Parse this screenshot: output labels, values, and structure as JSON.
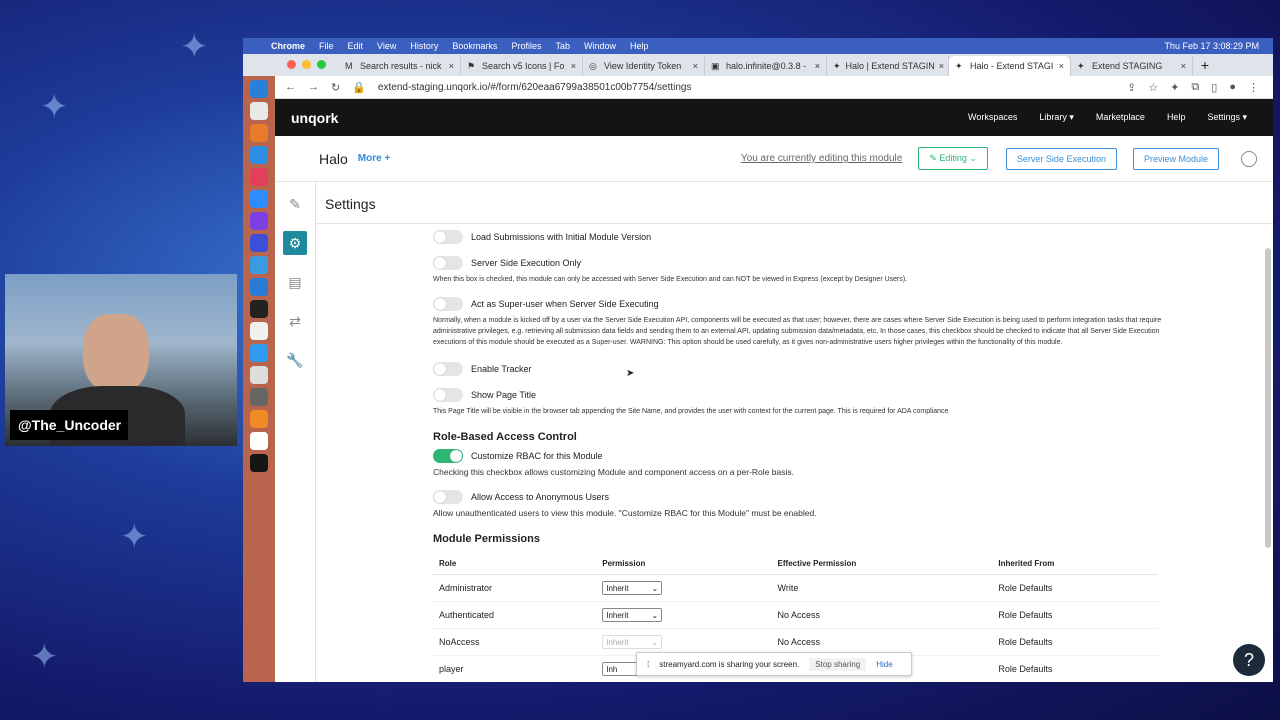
{
  "streamer": {
    "handle": "@The_Uncoder"
  },
  "menubar": {
    "app": "Chrome",
    "items": [
      "File",
      "Edit",
      "View",
      "History",
      "Bookmarks",
      "Profiles",
      "Tab",
      "Window",
      "Help"
    ],
    "clock": "Thu Feb 17  3:08:29 PM"
  },
  "tabs": [
    {
      "icon": "M",
      "label": "Search results - nick"
    },
    {
      "icon": "⚑",
      "label": "Search v5 Icons | Fo"
    },
    {
      "icon": "◎",
      "label": "View Identity Token"
    },
    {
      "icon": "▣",
      "label": "halo.infinite@0.3.8 -"
    },
    {
      "icon": "✦",
      "label": "Halo | Extend STAGIN"
    },
    {
      "icon": "✦",
      "label": "Halo - Extend STAGI"
    },
    {
      "icon": "✦",
      "label": "Extend STAGING"
    }
  ],
  "address": {
    "url": "extend-staging.unqork.io/#/form/620eaa6799a38501c00b7754/settings"
  },
  "nav": {
    "logo": "unqork",
    "links": [
      "Workspaces",
      "Library ▾",
      "Marketplace",
      "Help",
      "Settings ▾"
    ]
  },
  "header": {
    "title": "Halo",
    "more": "More +",
    "editing_note": "You are currently editing this module",
    "editing_btn": "✎  Editing  ⌄",
    "sse_btn": "Server Side Execution",
    "preview_btn": "Preview Module"
  },
  "settings": {
    "title": "Settings",
    "options": [
      {
        "label": "Load Submissions with Initial Module Version",
        "on": false,
        "desc": ""
      },
      {
        "label": "Server Side Execution Only",
        "on": false,
        "desc": "When this box is checked, this module can only be accessed with Server Side Execution and can NOT be viewed in Express (except by Designer Users)."
      },
      {
        "label": "Act as Super-user when Server Side Executing",
        "on": false,
        "desc": "Normally, when a module is kicked off by a user via the Server Side Execution API, components will be executed as that user; however, there are cases where Server Side Execution is being used to perform integration tasks that require administrative privileges, e.g. retrieving all submission data fields and sending them to an external API, updating submission data/metadata, etc. In those cases, this checkbox should be checked to indicate that all Server Side Execution executions of this module should be executed as a Super-user. WARNING: This option should be used carefully, as it gives non-administrative users higher privileges within the functionality of this module."
      },
      {
        "label": "Enable Tracker",
        "on": false,
        "desc": ""
      },
      {
        "label": "Show Page Title",
        "on": false,
        "desc": "This Page Title will be visible in the browser tab appending the Site Name, and provides the user with context for the current page. This is required for ADA compliance"
      }
    ]
  },
  "rbac": {
    "heading": "Role-Based Access Control",
    "options": [
      {
        "label": "Customize RBAC for this Module",
        "on": true,
        "desc": "Checking this checkbox allows customizing Module and component access on a per-Role basis."
      },
      {
        "label": "Allow Access to Anonymous Users",
        "on": false,
        "desc": "Allow unauthenticated users to view this module. \"Customize RBAC for this Module\" must be enabled."
      }
    ]
  },
  "permissions": {
    "heading": "Module Permissions",
    "columns": [
      "Role",
      "Permission",
      "Effective Permission",
      "Inherited From"
    ],
    "rows": [
      {
        "role": "Administrator",
        "permission": "Inherit",
        "effective": "Write",
        "inherited": "Role Defaults"
      },
      {
        "role": "Authenticated",
        "permission": "Inherit",
        "effective": "No Access",
        "inherited": "Role Defaults"
      },
      {
        "role": "NoAccess",
        "permission": "Inherit",
        "effective": "No Access",
        "inherited": "Role Defaults"
      },
      {
        "role": "player",
        "permission": "Inh",
        "effective": "",
        "inherited": "Role Defaults"
      }
    ]
  },
  "share_banner": {
    "text": "streamyard.com is sharing your screen.",
    "stop": "Stop sharing",
    "hide": "Hide"
  },
  "help_button": "?"
}
